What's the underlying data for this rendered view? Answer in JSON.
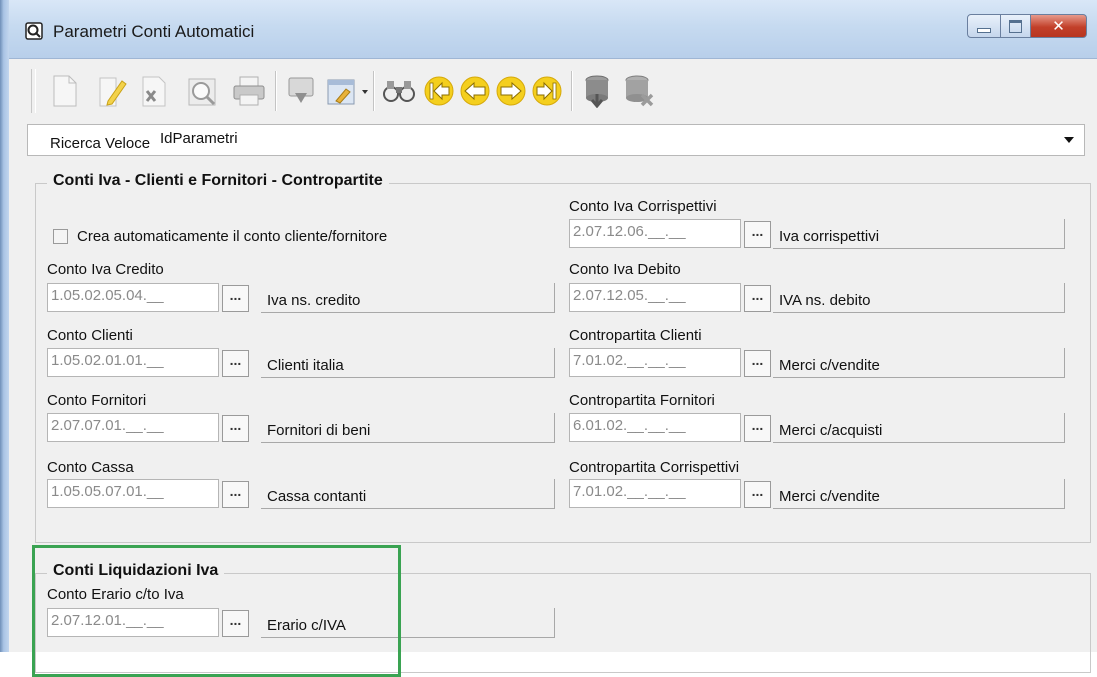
{
  "window": {
    "title": "Parametri Conti Automatici"
  },
  "toolbar": {
    "buttons": [
      {
        "icon": "new-document-icon",
        "disabled": true
      },
      {
        "icon": "edit-pencil-icon",
        "disabled": true
      },
      {
        "icon": "delete-x-icon",
        "disabled": true
      },
      {
        "icon": "preview-magnifier-icon",
        "disabled": true
      },
      {
        "icon": "print-icon",
        "disabled": true
      },
      {
        "icon": "copy-icon",
        "disabled": true
      },
      {
        "icon": "settings-dropdown-icon",
        "disabled": false
      },
      {
        "icon": "binoculars-search-icon",
        "disabled": false
      },
      {
        "icon": "first-record-icon",
        "disabled": false
      },
      {
        "icon": "previous-record-icon",
        "disabled": false
      },
      {
        "icon": "next-record-icon",
        "disabled": false
      },
      {
        "icon": "last-record-icon",
        "disabled": false
      },
      {
        "icon": "save-download-icon",
        "disabled": true
      },
      {
        "icon": "cancel-icon",
        "disabled": true
      }
    ]
  },
  "search": {
    "label": "Ricerca Veloce",
    "value": "IdParametri"
  },
  "group_iva": {
    "title": "Conti Iva - Clienti e Fornitori - Contropartite",
    "checkbox_label": "Crea automaticamente il conto cliente/fornitore",
    "checkbox_checked": false,
    "left_fields": [
      {
        "label": "Conto Iva Credito",
        "code": "1.05.02.05.04.__",
        "desc": "Iva ns. credito"
      },
      {
        "label": "Conto Clienti",
        "code": "1.05.02.01.01.__",
        "desc": "Clienti italia"
      },
      {
        "label": "Conto Fornitori",
        "code": "2.07.07.01.__.__",
        "desc": "Fornitori di beni"
      },
      {
        "label": "Conto Cassa",
        "code": "1.05.05.07.01.__",
        "desc": "Cassa contanti"
      }
    ],
    "right_fields": [
      {
        "label": "Conto Iva Corrispettivi",
        "code": "2.07.12.06.__.__",
        "desc": "Iva corrispettivi"
      },
      {
        "label": "Conto Iva Debito",
        "code": "2.07.12.05.__.__",
        "desc": "IVA ns. debito"
      },
      {
        "label": "Contropartita Clienti",
        "code": "7.01.02.__.__.__",
        "desc": "Merci c/vendite"
      },
      {
        "label": "Contropartita Fornitori",
        "code": "6.01.02.__.__.__",
        "desc": "Merci c/acquisti"
      },
      {
        "label": "Contropartita Corrispettivi",
        "code": "7.01.02.__.__.__",
        "desc": "Merci c/vendite"
      }
    ]
  },
  "group_liq": {
    "title": "Conti Liquidazioni Iva",
    "field": {
      "label": "Conto Erario c/to Iva",
      "code": "2.07.12.01.__.__",
      "desc": "Erario c/IVA"
    }
  },
  "browse_label": "...",
  "colors": {
    "highlight": "#3aa352",
    "toolbar_yellow": "#f4cf1e"
  }
}
